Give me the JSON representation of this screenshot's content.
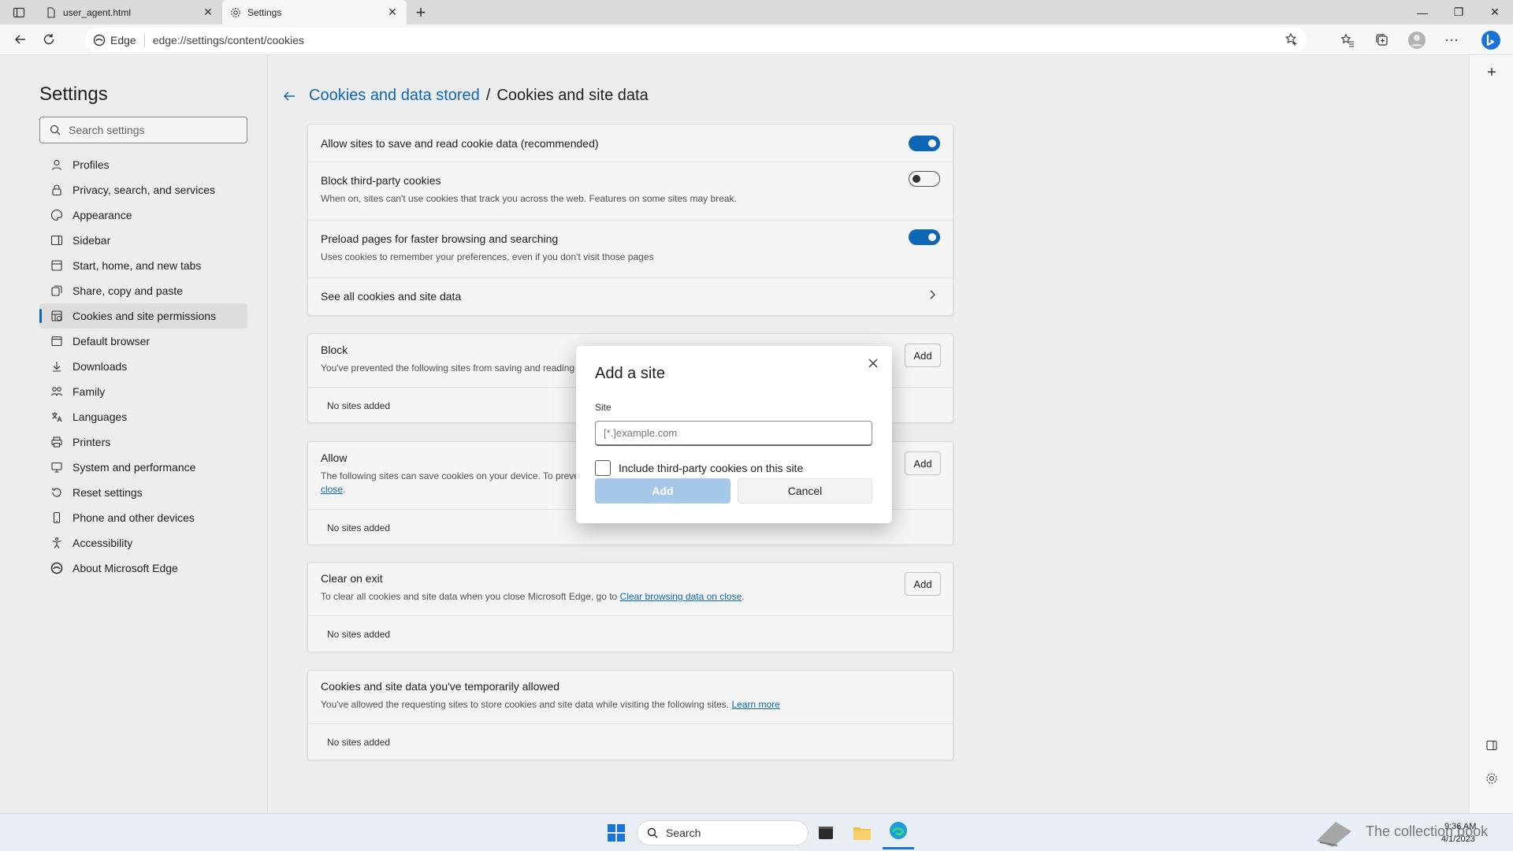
{
  "browser": {
    "tabs": [
      {
        "label": "user_agent.html",
        "icon": "file-icon",
        "active": false
      },
      {
        "label": "Settings",
        "icon": "gear-icon",
        "active": true
      }
    ],
    "address": {
      "chip": "Edge",
      "url": "edge://settings/content/cookies"
    }
  },
  "sidebar": {
    "title": "Settings",
    "search_placeholder": "Search settings",
    "items": [
      {
        "label": "Profiles",
        "icon": "profile-icon"
      },
      {
        "label": "Privacy, search, and services",
        "icon": "lock-icon"
      },
      {
        "label": "Appearance",
        "icon": "appearance-icon"
      },
      {
        "label": "Sidebar",
        "icon": "sidebar-icon"
      },
      {
        "label": "Start, home, and new tabs",
        "icon": "home-icon"
      },
      {
        "label": "Share, copy and paste",
        "icon": "share-icon"
      },
      {
        "label": "Cookies and site permissions",
        "icon": "cookies-icon",
        "selected": true
      },
      {
        "label": "Default browser",
        "icon": "browser-icon"
      },
      {
        "label": "Downloads",
        "icon": "download-icon"
      },
      {
        "label": "Family",
        "icon": "family-icon"
      },
      {
        "label": "Languages",
        "icon": "language-icon"
      },
      {
        "label": "Printers",
        "icon": "printer-icon"
      },
      {
        "label": "System and performance",
        "icon": "system-icon"
      },
      {
        "label": "Reset settings",
        "icon": "reset-icon"
      },
      {
        "label": "Phone and other devices",
        "icon": "phone-icon"
      },
      {
        "label": "Accessibility",
        "icon": "accessibility-icon"
      },
      {
        "label": "About Microsoft Edge",
        "icon": "edge-icon"
      }
    ]
  },
  "main": {
    "breadcrumb": {
      "parent": "Cookies and data stored",
      "separator": "/",
      "current": "Cookies and site data"
    },
    "settings": [
      {
        "title": "Allow sites to save and read cookie data (recommended)",
        "desc": "",
        "toggle": "on"
      },
      {
        "title": "Block third-party cookies",
        "desc": "When on, sites can't use cookies that track you across the web. Features on some sites may break.",
        "toggle": "off"
      },
      {
        "title": "Preload pages for faster browsing and searching",
        "desc": "Uses cookies to remember your preferences, even if you don't visit those pages",
        "toggle": "on"
      },
      {
        "title": "See all cookies and site data",
        "desc": "",
        "toggle": "none"
      }
    ],
    "block": {
      "title": "Block",
      "desc": "You've prevented the following sites from saving and reading",
      "add": "Add",
      "empty": "No sites added"
    },
    "allow": {
      "title": "Allow",
      "desc_a": "The following sites can save cookies on your device. To prever",
      "desc_link": "close",
      "desc_end": ".",
      "add": "Add",
      "empty": "No sites added"
    },
    "clear_on_exit": {
      "title": "Clear on exit",
      "desc": "To clear all cookies and site data when you close Microsoft Edge, go to ",
      "link": "Clear browsing data on close",
      "end": ".",
      "add": "Add",
      "empty": "No sites added"
    },
    "temp_allowed": {
      "title": "Cookies and site data you've temporarily allowed",
      "desc": "You've allowed the requesting sites to store cookies and site data while visiting the following sites. ",
      "link": "Learn more",
      "empty": "No sites added"
    }
  },
  "dialog": {
    "title": "Add a site",
    "field_label": "Site",
    "placeholder": "[*.]example.com",
    "value": "",
    "checkbox_label": "Include third-party cookies on this site",
    "checkbox_checked": false,
    "add_label": "Add",
    "cancel_label": "Cancel"
  },
  "taskbar": {
    "search_label": "Search",
    "time": "9:36 AM",
    "date": "4/1/2023",
    "brand": "The collection book"
  },
  "colors": {
    "accent": "#0f6cbd",
    "disabled_button": "#a6c8e8"
  }
}
